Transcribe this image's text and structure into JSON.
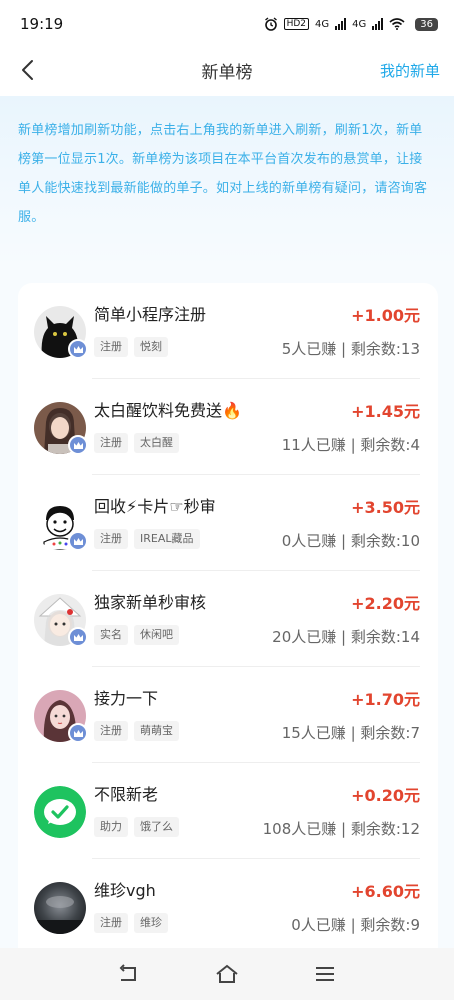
{
  "status_bar": {
    "time": "19:19",
    "hd_label": "HD2",
    "net1": "4G",
    "net2": "4G",
    "battery": "36"
  },
  "header": {
    "title": "新单榜",
    "right_link": "我的新单"
  },
  "notice": {
    "text": "新单榜增加刷新功能，点击右上角我的新单进入刷新，刷新1次，新单榜第一位显示1次。新单榜为该项目在本平台首次发布的悬赏单，让接单人能快速找到最新能做的单子。如对上线的新单榜有疑问，请咨询客服。"
  },
  "colors": {
    "accent": "#1fa8e8",
    "notice_text": "#3bb0e8",
    "reward": "#e2452f",
    "crown_badge": "#6e8fd6"
  },
  "tasks": [
    {
      "title": "简单小程序注册",
      "reward": "+1.00元",
      "tags": [
        "注册",
        "悦刻"
      ],
      "stats": "5人已赚 | 剩余数:13",
      "avatar": "black-cat-avatar",
      "crown": true
    },
    {
      "title": "太白醒饮料免费送🔥",
      "reward": "+1.45元",
      "tags": [
        "注册",
        "太白醒"
      ],
      "stats": "11人已赚 | 剩余数:4",
      "avatar": "girl-photo-avatar",
      "crown": true
    },
    {
      "title": "回收⚡卡片☞秒审",
      "reward": "+3.50元",
      "tags": [
        "注册",
        "IREAL藏品"
      ],
      "stats": "0人已赚 | 剩余数:10",
      "avatar": "cartoon-face-avatar",
      "crown": true
    },
    {
      "title": "独家新单秒审核",
      "reward": "+2.20元",
      "tags": [
        "实名",
        "休闲吧"
      ],
      "stats": "20人已赚 | 剩余数:14",
      "avatar": "anime-girl-avatar",
      "crown": true
    },
    {
      "title": "接力一下",
      "reward": "+1.70元",
      "tags": [
        "注册",
        "萌萌宝"
      ],
      "stats": "15人已赚 | 剩余数:7",
      "avatar": "girl-pink-avatar",
      "crown": true
    },
    {
      "title": "不限新老",
      "reward": "+0.20元",
      "tags": [
        "助力",
        "饿了么"
      ],
      "stats": "108人已赚 | 剩余数:12",
      "avatar": "green-check-avatar",
      "crown": false
    },
    {
      "title": "维珍vgh",
      "reward": "+6.60元",
      "tags": [
        "注册",
        "维珍"
      ],
      "stats": "0人已赚 | 剩余数:9",
      "avatar": "night-sky-avatar",
      "crown": false
    }
  ],
  "nav": {
    "items": [
      "back-nav",
      "home-nav",
      "menu-nav"
    ]
  }
}
